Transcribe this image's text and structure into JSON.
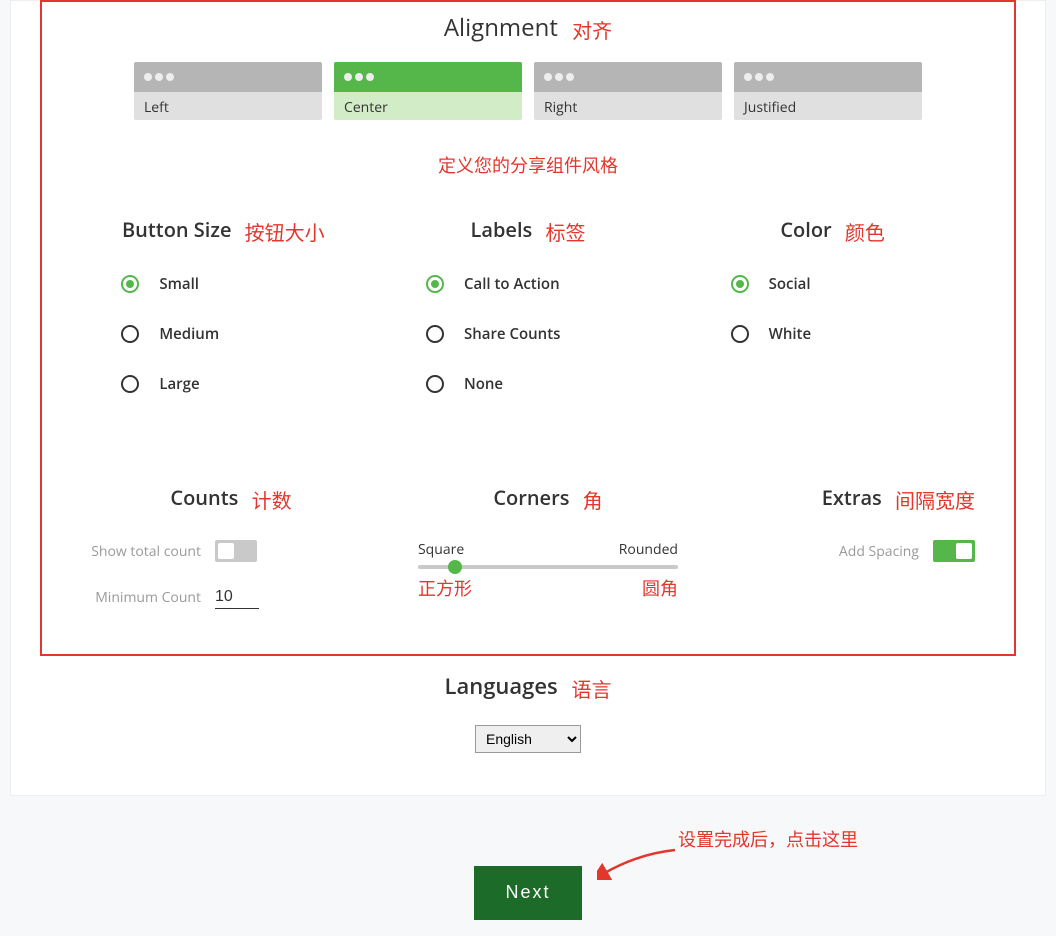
{
  "alignment": {
    "title": "Alignment",
    "anno": "对齐",
    "options": [
      {
        "label": "Left",
        "selected": false
      },
      {
        "label": "Center",
        "selected": true
      },
      {
        "label": "Right",
        "selected": false
      },
      {
        "label": "Justified",
        "selected": false
      }
    ]
  },
  "style_caption": "定义您的分享组件风格",
  "buttonSize": {
    "title": "Button Size",
    "anno": "按钮大小",
    "options": [
      {
        "label": "Small",
        "selected": true
      },
      {
        "label": "Medium",
        "selected": false
      },
      {
        "label": "Large",
        "selected": false
      }
    ]
  },
  "labels": {
    "title": "Labels",
    "anno": "标签",
    "options": [
      {
        "label": "Call to Action",
        "selected": true
      },
      {
        "label": "Share Counts",
        "selected": false
      },
      {
        "label": "None",
        "selected": false
      }
    ]
  },
  "color": {
    "title": "Color",
    "anno": "颜色",
    "options": [
      {
        "label": "Social",
        "selected": true
      },
      {
        "label": "White",
        "selected": false
      }
    ]
  },
  "counts": {
    "title": "Counts",
    "anno": "计数",
    "show_label": "Show total count",
    "show_value": false,
    "min_label": "Minimum Count",
    "min_value": "10"
  },
  "corners": {
    "title": "Corners",
    "anno": "角",
    "left_label": "Square",
    "right_label": "Rounded",
    "left_anno": "正方形",
    "right_anno": "圆角"
  },
  "extras": {
    "title": "Extras",
    "anno": "间隔宽度",
    "spacing_label": "Add Spacing",
    "spacing_value": true
  },
  "languages": {
    "title": "Languages",
    "anno": "语言",
    "selected": "English"
  },
  "bottom": {
    "note": "设置完成后，点击这里",
    "next_label": "Next"
  }
}
